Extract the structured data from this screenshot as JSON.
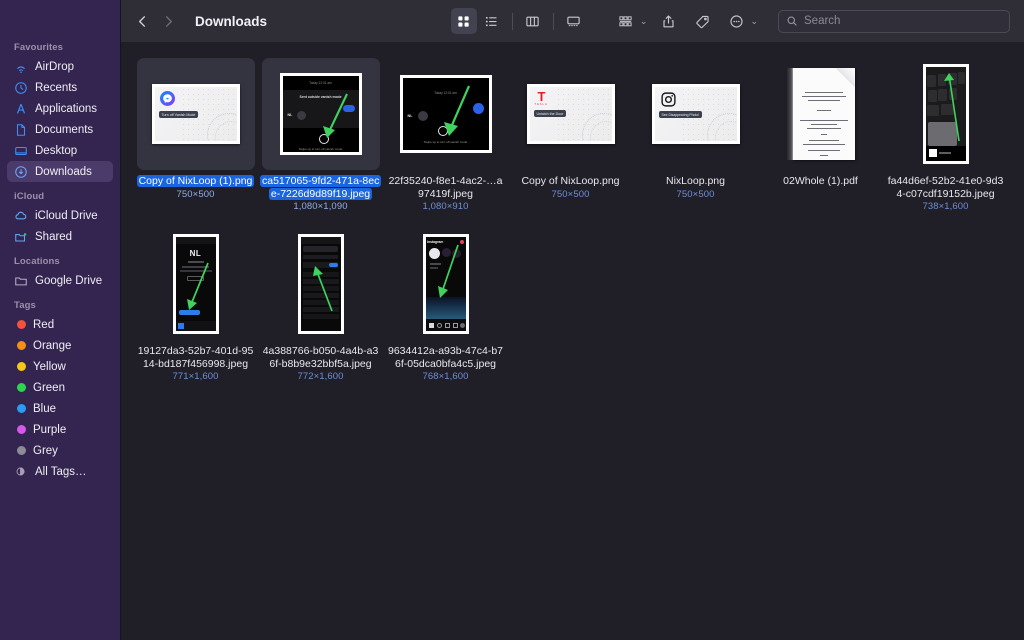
{
  "window": {
    "title": "Downloads"
  },
  "toolbar": {
    "back_icon": "chevron-left-icon",
    "forward_icon": "chevron-right-icon",
    "path_label": "Downloads",
    "views": [
      {
        "name": "icon-view",
        "icon": "grid-icon",
        "selected": true
      },
      {
        "name": "list-view",
        "icon": "list-icon",
        "selected": false
      },
      {
        "name": "column-view",
        "icon": "columns-icon",
        "selected": false
      },
      {
        "name": "gallery-view",
        "icon": "gallery-icon",
        "selected": false
      }
    ],
    "group_icon": "group-by-icon",
    "share_icon": "share-icon",
    "tag_icon": "tag-icon",
    "more_icon": "more-options-icon",
    "chevron": "⌄"
  },
  "search": {
    "placeholder": "Search",
    "value": "",
    "icon": "search-icon"
  },
  "sidebar": {
    "sections": [
      {
        "title": "Favourites",
        "items": [
          {
            "label": "AirDrop",
            "icon": "airdrop-icon",
            "active": false
          },
          {
            "label": "Recents",
            "icon": "clock-icon",
            "active": false
          },
          {
            "label": "Applications",
            "icon": "applications-icon",
            "active": false
          },
          {
            "label": "Documents",
            "icon": "document-icon",
            "active": false
          },
          {
            "label": "Desktop",
            "icon": "desktop-icon",
            "active": false
          },
          {
            "label": "Downloads",
            "icon": "downloads-icon",
            "active": true
          }
        ]
      },
      {
        "title": "iCloud",
        "items": [
          {
            "label": "iCloud Drive",
            "icon": "cloud-icon",
            "active": false
          },
          {
            "label": "Shared",
            "icon": "shared-folder-icon",
            "active": false
          }
        ]
      },
      {
        "title": "Locations",
        "items": [
          {
            "label": "Google Drive",
            "icon": "folder-icon",
            "active": false
          }
        ]
      }
    ],
    "tags_title": "Tags",
    "tags": [
      {
        "label": "Red",
        "color": "#f4523d"
      },
      {
        "label": "Orange",
        "color": "#f49015"
      },
      {
        "label": "Yellow",
        "color": "#f6c915"
      },
      {
        "label": "Green",
        "color": "#2cd44f"
      },
      {
        "label": "Blue",
        "color": "#2a9bf7"
      },
      {
        "label": "Purple",
        "color": "#d559e8"
      },
      {
        "label": "Grey",
        "color": "#8e8b98"
      }
    ],
    "all_tags": {
      "label": "All Tags…",
      "icon": "all-tags-icon"
    }
  },
  "files": [
    {
      "name": "Copy of NixLoop (1).png",
      "dims": "750×500",
      "selected": true,
      "thumb": "messenger-card",
      "art_label": "Turn off Vanish Mode",
      "brand": "messenger"
    },
    {
      "name": "ca517065-9fd2-471a-8ece-7226d9d89f19.jpeg",
      "dims": "1,080×1,090",
      "selected": true,
      "thumb": "chat-square",
      "art_top": "Today 12:01 am",
      "art_mid": "Sent outside vanish mode",
      "art_bottom": "Swipe up to turn off vanish mode",
      "art_avatar": "NL"
    },
    {
      "name": "22f35240-f8e1-4ac2-…a97419f.jpeg",
      "dims": "1,080×910",
      "selected": false,
      "thumb": "chat-wide",
      "art_top": "Today 12:01 am",
      "art_bottom": "Swipe up to turn off vanish mode",
      "art_avatar": "NL"
    },
    {
      "name": "Copy of NixLoop.png",
      "dims": "750×500",
      "selected": false,
      "thumb": "tesla-card",
      "art_label": "Unlatch the Door",
      "brand": "tesla"
    },
    {
      "name": "NixLoop.png",
      "dims": "750×500",
      "selected": false,
      "thumb": "instagram-card",
      "art_label": "See Disappearing Photo!",
      "brand": "instagram"
    },
    {
      "name": "02Whole (1).pdf",
      "dims": "",
      "selected": false,
      "thumb": "pdf-document"
    },
    {
      "name": "fa44d6ef-52b2-41e0-9d34-c07cdf19152b.jpeg",
      "dims": "738×1,600",
      "selected": false,
      "thumb": "keyboard-photo"
    },
    {
      "name": "19127da3-52b7-401d-9514-bd187f456998.jpeg",
      "dims": "771×1,600",
      "selected": false,
      "thumb": "phone-nl",
      "art_avatar": "NL"
    },
    {
      "name": "4a388766-b050-4a4b-a36f-b8b9e32bbf5a.jpeg",
      "dims": "772×1,600",
      "selected": false,
      "thumb": "phone-list"
    },
    {
      "name": "9634412a-a93b-47c4-b76f-05dca0bfa4c5.jpeg",
      "dims": "768×1,600",
      "selected": false,
      "thumb": "phone-instagram"
    }
  ],
  "colors": {
    "sidebar_bg": "#33254f",
    "content_bg": "#201e26",
    "toolbar_bg": "#2f2e36",
    "selection_blue": "#1a66e0",
    "dims_blue": "#6e8fd6"
  }
}
